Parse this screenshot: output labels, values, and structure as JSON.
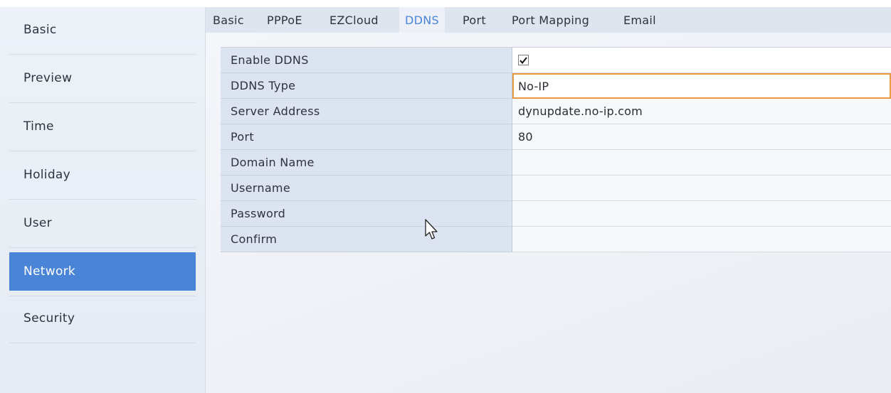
{
  "sidebar": {
    "items": [
      {
        "label": "Basic"
      },
      {
        "label": "Preview"
      },
      {
        "label": "Time"
      },
      {
        "label": "Holiday"
      },
      {
        "label": "User"
      },
      {
        "label": "Network"
      },
      {
        "label": "Security"
      }
    ],
    "active": "Network"
  },
  "tabs": [
    {
      "label": "Basic"
    },
    {
      "label": "PPPoE"
    },
    {
      "label": "EZCloud"
    },
    {
      "label": "DDNS"
    },
    {
      "label": "Port"
    },
    {
      "label": "Port Mapping"
    },
    {
      "label": "Email"
    }
  ],
  "active_tab": "DDNS",
  "form": {
    "enable_ddns": {
      "label": "Enable DDNS",
      "checked": true
    },
    "ddns_type": {
      "label": "DDNS Type",
      "value": "No-IP"
    },
    "server_address": {
      "label": "Server Address",
      "value": "dynupdate.no-ip.com"
    },
    "port": {
      "label": "Port",
      "value": "80"
    },
    "domain_name": {
      "label": "Domain Name",
      "value": ""
    },
    "username": {
      "label": "Username",
      "value": ""
    },
    "password": {
      "label": "Password",
      "value": ""
    },
    "confirm": {
      "label": "Confirm",
      "value": ""
    }
  },
  "colors": {
    "accent": "#4a84d6",
    "focus_border": "#e99a3c"
  },
  "icons": {
    "checkmark": "check-icon",
    "pointer": "mouse-pointer-icon"
  }
}
